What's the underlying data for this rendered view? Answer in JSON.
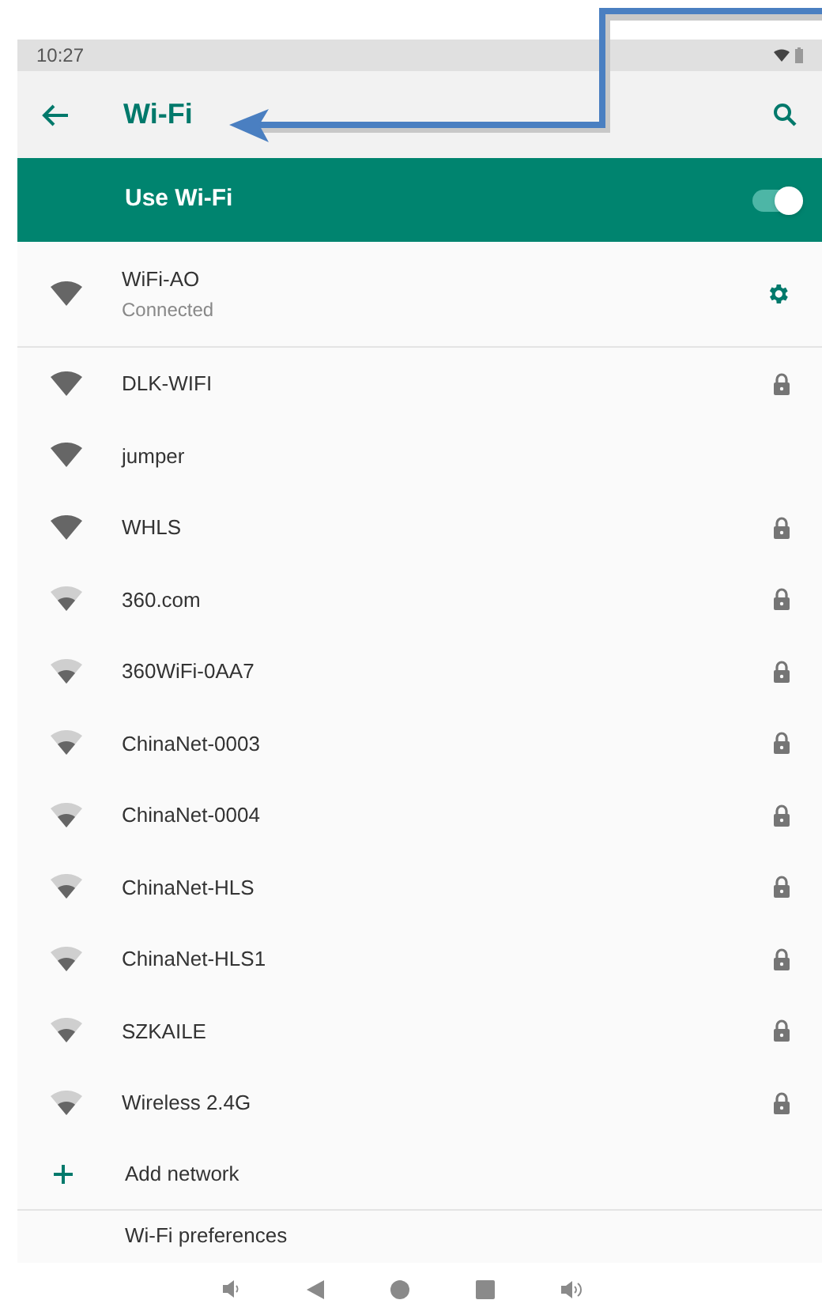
{
  "status_bar": {
    "time": "10:27"
  },
  "app_bar": {
    "title": "Wi-Fi"
  },
  "master_switch": {
    "label": "Use Wi-Fi",
    "on": true
  },
  "connected": {
    "name": "WiFi-AO",
    "status": "Connected",
    "kind": "full"
  },
  "networks": [
    {
      "name": "DLK-WIFI",
      "kind": "full",
      "locked": true
    },
    {
      "name": "jumper",
      "kind": "full",
      "locked": false
    },
    {
      "name": "WHLS",
      "kind": "full",
      "locked": true
    },
    {
      "name": "360.com",
      "kind": "partial",
      "locked": true
    },
    {
      "name": "360WiFi-0AA7",
      "kind": "partial",
      "locked": true
    },
    {
      "name": "ChinaNet-0003",
      "kind": "partial",
      "locked": true
    },
    {
      "name": "ChinaNet-0004",
      "kind": "partial",
      "locked": true
    },
    {
      "name": "ChinaNet-HLS",
      "kind": "partial",
      "locked": true
    },
    {
      "name": "ChinaNet-HLS1",
      "kind": "partial",
      "locked": true
    },
    {
      "name": "SZKAILE",
      "kind": "partial",
      "locked": true
    },
    {
      "name": "Wireless 2.4G",
      "kind": "partial",
      "locked": true
    }
  ],
  "add_network": {
    "label": "Add network"
  },
  "preferences": {
    "label": "Wi-Fi preferences"
  }
}
